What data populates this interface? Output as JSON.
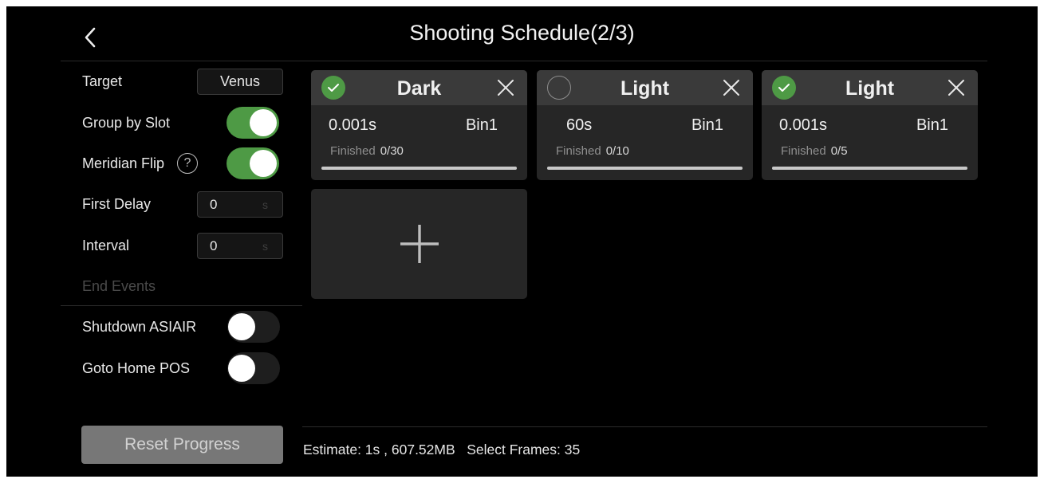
{
  "header": {
    "title": "Shooting Schedule(2/3)"
  },
  "settings": {
    "target_label": "Target",
    "target_value": "Venus",
    "group_by_slot_label": "Group by Slot",
    "group_by_slot_on": true,
    "meridian_flip_label": "Meridian Flip",
    "meridian_flip_help": "?",
    "meridian_flip_on": true,
    "first_delay_label": "First Delay",
    "first_delay_value": "0",
    "first_delay_unit": "s",
    "interval_label": "Interval",
    "interval_value": "0",
    "interval_unit": "s"
  },
  "end_events": {
    "title": "End Events",
    "shutdown_label": "Shutdown ASIAIR",
    "shutdown_on": false,
    "goto_home_label": "Goto Home POS",
    "goto_home_on": false
  },
  "reset_label": "Reset Progress",
  "cards": [
    {
      "type": "Dark",
      "exposure": "0.001s",
      "bin": "Bin1",
      "finished_label": "Finished",
      "finished": "0/30",
      "checked": true,
      "progress": 1.0
    },
    {
      "type": "Light",
      "exposure": "60s",
      "bin": "Bin1",
      "finished_label": "Finished",
      "finished": "0/10",
      "checked": false,
      "progress": 1.0
    },
    {
      "type": "Light",
      "exposure": "0.001s",
      "bin": "Bin1",
      "finished_label": "Finished",
      "finished": "0/5",
      "checked": true,
      "progress": 1.0
    }
  ],
  "footer": {
    "estimate": "Estimate: 1s , 607.52MB   Select Frames: 35"
  },
  "colors": {
    "toggle_on": "#4e9a45",
    "background": "#000000",
    "card": "#262626",
    "card_header": "#3a3a3a"
  },
  "icons": {
    "back": "chevron-left-icon",
    "help": "question-circle-icon",
    "close": "close-icon",
    "check": "check-circle-icon",
    "add": "plus-icon"
  }
}
